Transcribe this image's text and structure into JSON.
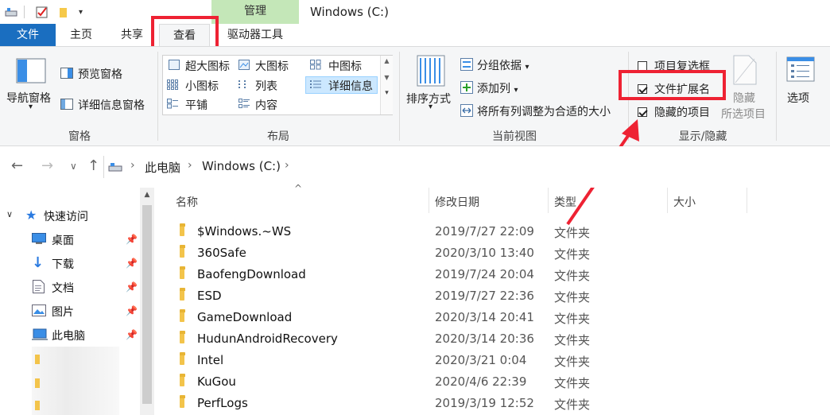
{
  "context_tab": "管理",
  "window_title": "Windows (C:)",
  "tabs": {
    "file": "文件",
    "home": "主页",
    "share": "共享",
    "view": "查看",
    "drive": "驱动器工具"
  },
  "ribbon": {
    "pane_group": {
      "nav_pane": "导航窗格",
      "preview": "预览窗格",
      "details": "详细信息窗格",
      "label": "窗格"
    },
    "layout_group": {
      "xl_icons": "超大图标",
      "large_icons": "大图标",
      "medium_icons": "中图标",
      "small_icons": "小图标",
      "list": "列表",
      "details": "详细信息",
      "tiles": "平铺",
      "content": "内容",
      "label": "布局"
    },
    "view_group": {
      "sort": "排序方式",
      "group_by": "分组依据",
      "add_column": "添加列",
      "fit_columns": "将所有列调整为合适的大小",
      "label": "当前视图"
    },
    "show_group": {
      "item_checkbox": "项目复选框",
      "file_ext": "文件扩展名",
      "hidden_items": "隐藏的项目",
      "hide": "隐藏",
      "selected_items": "所选项目",
      "label": "显示/隐藏",
      "item_checkbox_checked": false,
      "file_ext_checked": true,
      "hidden_items_checked": true
    },
    "options": "选项"
  },
  "address": {
    "crumb1": "此电脑",
    "crumb2": "Windows (C:)"
  },
  "nav_pane": {
    "quick_access": "快速访问",
    "desktop": "桌面",
    "downloads": "下载",
    "documents": "文档",
    "pictures": "图片",
    "this_pc": "此电脑"
  },
  "columns": {
    "name": "名称",
    "date": "修改日期",
    "type": "类型",
    "size": "大小"
  },
  "files": [
    {
      "name": "$Windows.~WS",
      "date": "2019/7/27 22:09",
      "type": "文件夹"
    },
    {
      "name": "360Safe",
      "date": "2020/3/10 13:40",
      "type": "文件夹"
    },
    {
      "name": "BaofengDownload",
      "date": "2019/7/24 20:04",
      "type": "文件夹"
    },
    {
      "name": "ESD",
      "date": "2019/7/27 22:36",
      "type": "文件夹"
    },
    {
      "name": "GameDownload",
      "date": "2020/3/14 20:41",
      "type": "文件夹"
    },
    {
      "name": "HudunAndroidRecovery",
      "date": "2020/3/14 20:36",
      "type": "文件夹"
    },
    {
      "name": "Intel",
      "date": "2020/3/21 0:04",
      "type": "文件夹"
    },
    {
      "name": "KuGou",
      "date": "2020/4/6 22:39",
      "type": "文件夹"
    },
    {
      "name": "PerfLogs",
      "date": "2019/3/19 12:52",
      "type": "文件夹"
    }
  ],
  "colors": {
    "accent": "#1a6ec0",
    "highlight": "#ee2233",
    "context_tab": "#c4e7b8",
    "folder": "#f6c94a"
  }
}
